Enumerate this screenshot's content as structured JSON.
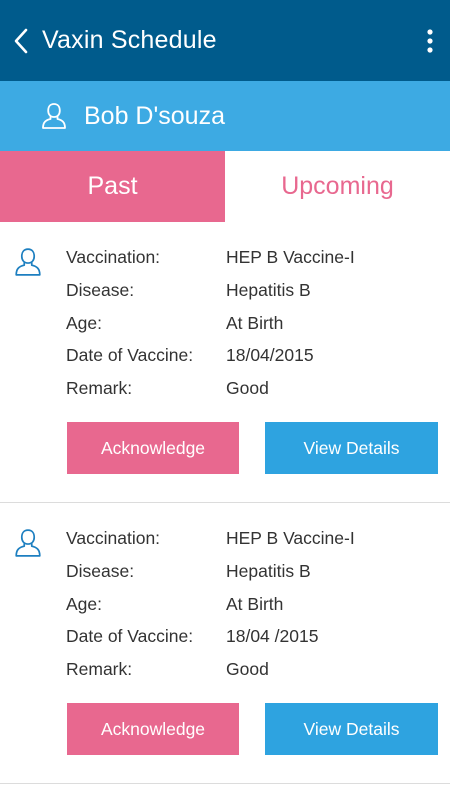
{
  "app_bar": {
    "title": "Vaxin Schedule",
    "back_icon": "chevron-left-icon",
    "menu_icon": "more-vertical-icon"
  },
  "user": {
    "name": "Bob D'souza",
    "icon": "user-icon"
  },
  "tabs": [
    {
      "label": "Past",
      "active": true
    },
    {
      "label": "Upcoming",
      "active": false
    }
  ],
  "labels": {
    "vaccination": "Vaccination:",
    "disease": "Disease:",
    "age": "Age:",
    "date": "Date of Vaccine:",
    "remark": "Remark:"
  },
  "cards": [
    {
      "vaccination": "HEP B Vaccine-I",
      "disease": "Hepatitis B",
      "age": "At Birth",
      "date": "18/04/2015",
      "remark": "Good",
      "acknowledge_label": "Acknowledge",
      "details_label": "View Details"
    },
    {
      "vaccination": "HEP B Vaccine-I",
      "disease": "Hepatitis B",
      "age": "At Birth",
      "date": "18/04 /2015",
      "remark": "Good",
      "acknowledge_label": "Acknowledge",
      "details_label": "View Details"
    }
  ],
  "colors": {
    "app_bar": "#005b8c",
    "user_bar": "#3daae3",
    "accent_pink": "#e8688f",
    "accent_blue": "#2ea3e0"
  }
}
